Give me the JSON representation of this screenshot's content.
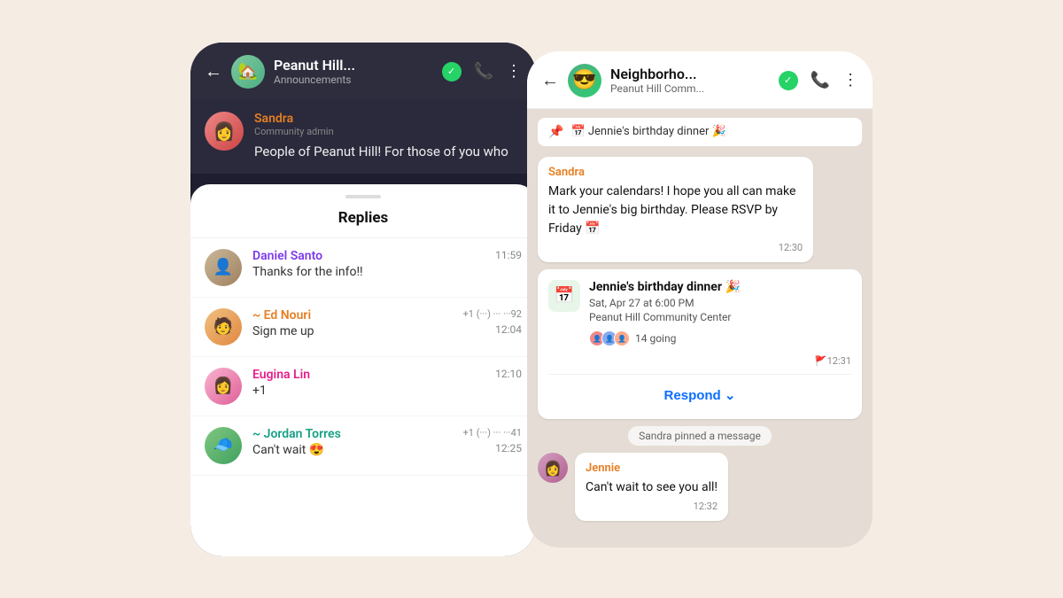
{
  "background_color": "#f5ede4",
  "left_phone": {
    "header": {
      "back_label": "←",
      "title": "Peanut Hill...",
      "subtitle": "Announcements",
      "call_icon": "📞",
      "more_icon": "⋮"
    },
    "announcement": {
      "sender_name": "Sandra",
      "sender_role": "Community admin",
      "message": "People of Peanut Hill! For those of you who"
    },
    "sheet": {
      "handle": true,
      "title": "Replies",
      "replies": [
        {
          "name": "Daniel Santo",
          "name_color": "purple",
          "message": "Thanks for the info!!",
          "phone": "",
          "time": "11:59",
          "avatar_emoji": "👤"
        },
        {
          "name": "~ Ed Nouri",
          "name_color": "orange",
          "message": "Sign me up",
          "phone": "+1 (···) ··· ···92",
          "time": "12:04",
          "avatar_emoji": "🧑"
        },
        {
          "name": "Eugina Lin",
          "name_color": "pink",
          "message": "+1",
          "phone": "",
          "time": "12:10",
          "avatar_emoji": "👩"
        },
        {
          "name": "~ Jordan Torres",
          "name_color": "green",
          "message": "Can't wait 😍",
          "phone": "+1 (···) ··· ···41",
          "time": "12:25",
          "avatar_emoji": "🧢"
        }
      ]
    }
  },
  "right_phone": {
    "header": {
      "back_label": "←",
      "avatar_emoji": "😎",
      "title": "Neighborho...",
      "subtitle": "Peanut Hill Comm...",
      "call_icon": "📞",
      "more_icon": "⋮"
    },
    "chat": {
      "pinned_bar": "📅 Jennie's birthday dinner 🎉",
      "messages": [
        {
          "type": "bubble",
          "sender": "Sandra",
          "sender_color": "orange",
          "text": "Mark your calendars! I hope you all can make it to Jennie's big birthday. Please RSVP by Friday 📅",
          "time": "12:30"
        },
        {
          "type": "event",
          "title": "Jennie's birthday dinner 🎉",
          "date": "Sat, Apr 27 at 6:00 PM",
          "location": "Peanut Hill Community Center",
          "going_count": "14 going",
          "time": "🚩12:31",
          "respond_label": "Respond ⌄"
        },
        {
          "type": "system",
          "text": "Sandra pinned a message"
        },
        {
          "type": "jennie",
          "sender": "Jennie",
          "sender_color": "green",
          "text": "Can't wait to see you all!",
          "time": "12:32"
        }
      ]
    }
  }
}
